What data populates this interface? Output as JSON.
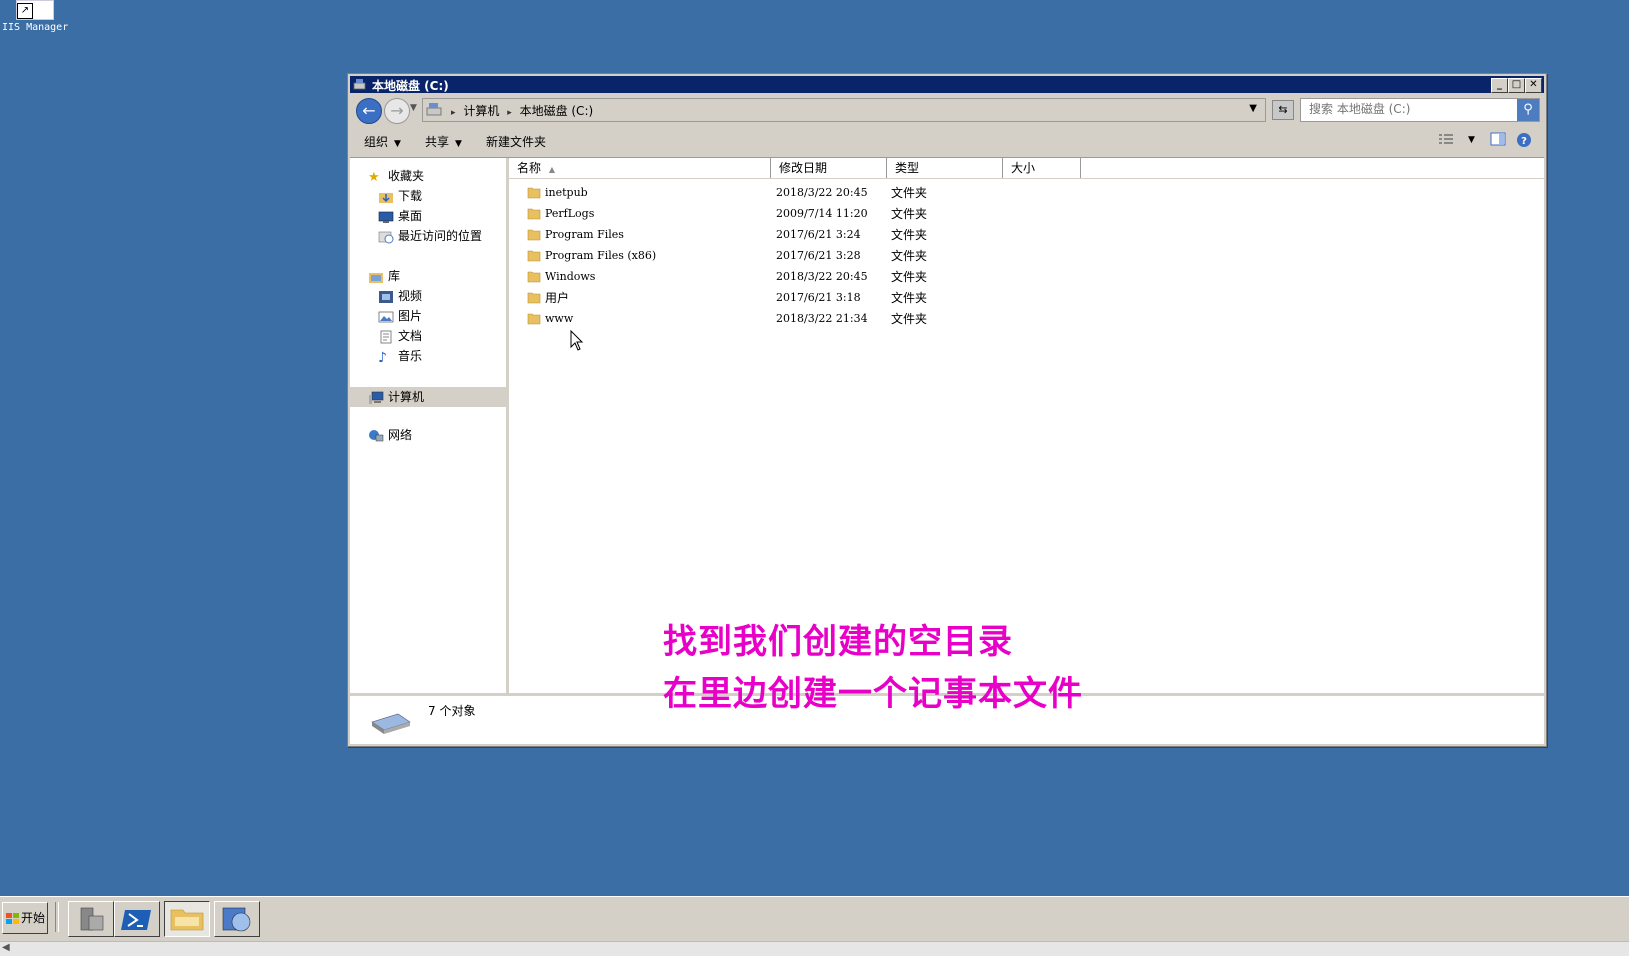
{
  "desktop": {
    "icon_label": "IIS Manager"
  },
  "window": {
    "title": "本地磁盘 (C:)",
    "controls": {
      "minimize": "_",
      "maximize": "□",
      "close": "✕"
    }
  },
  "address": {
    "crumbs": [
      "计算机",
      "本地磁盘 (C:)"
    ]
  },
  "search": {
    "placeholder": "搜索 本地磁盘 (C:)"
  },
  "toolbar": {
    "organize": "组织",
    "share": "共享",
    "new_folder": "新建文件夹"
  },
  "nav_pane": {
    "favorites": "收藏夹",
    "downloads": "下载",
    "desktop": "桌面",
    "recent": "最近访问的位置",
    "libraries": "库",
    "videos": "视频",
    "pictures": "图片",
    "documents": "文档",
    "music": "音乐",
    "computer": "计算机",
    "network": "网络"
  },
  "columns": {
    "name": "名称",
    "modified": "修改日期",
    "type": "类型",
    "size": "大小"
  },
  "files": [
    {
      "name": "inetpub",
      "modified": "2018/3/22 20:45",
      "type": "文件夹"
    },
    {
      "name": "PerfLogs",
      "modified": "2009/7/14 11:20",
      "type": "文件夹"
    },
    {
      "name": "Program Files",
      "modified": "2017/6/21 3:24",
      "type": "文件夹"
    },
    {
      "name": "Program Files (x86)",
      "modified": "2017/6/21 3:28",
      "type": "文件夹"
    },
    {
      "name": "Windows",
      "modified": "2018/3/22 20:45",
      "type": "文件夹"
    },
    {
      "name": "用户",
      "modified": "2017/6/21 3:18",
      "type": "文件夹"
    },
    {
      "name": "www",
      "modified": "2018/3/22 21:34",
      "type": "文件夹"
    }
  ],
  "status": {
    "count": "7 个对象"
  },
  "overlay": {
    "line1": "找到我们创建的空目录",
    "line2": "在里边创建一个记事本文件"
  },
  "taskbar": {
    "start_label": "开始"
  },
  "colors": {
    "desktop": "#3a6ea5",
    "title_bar": "#0a246a",
    "overlay_text": "#e800c8"
  }
}
